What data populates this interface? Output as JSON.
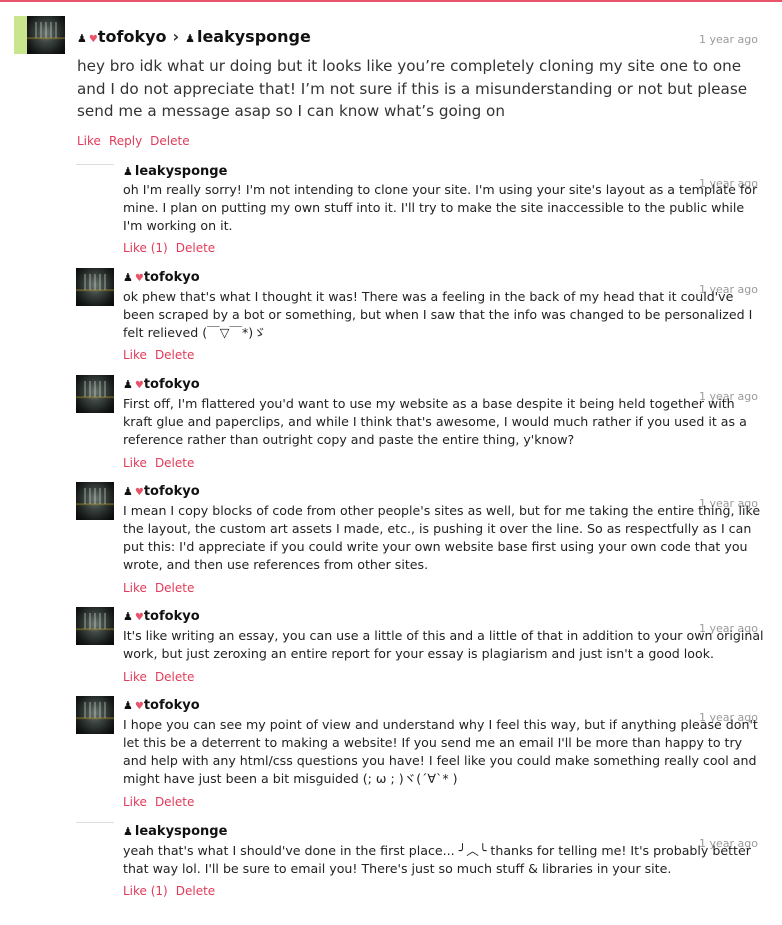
{
  "main": {
    "author": "tofokyo",
    "recipient": "leakysponge",
    "separator": "›",
    "timestamp": "1 year ago",
    "text": "hey bro idk what ur doing but it looks like you’re completely cloning my site one to one and I do not appreciate that! I’m not sure if this is a misunderstanding or not but please send me a message asap so I can know what’s going on",
    "actions": {
      "like": "Like",
      "reply": "Reply",
      "delete": "Delete"
    }
  },
  "icons": {
    "user": "user-icon",
    "heart": "heart-icon",
    "accent": "#e8556b"
  },
  "replies": [
    {
      "author": "leakysponge",
      "timestamp": "1 year ago",
      "text": "oh I'm really sorry! I'm not intending to clone your site. I'm using your site's layout as a template for mine. I plan on putting my own stuff into it. I'll try to make the site inaccessible to the public while I'm working on it.",
      "like": "Like (1)",
      "delete": "Delete"
    },
    {
      "author": "tofokyo",
      "timestamp": "1 year ago",
      "text": "ok phew that's what I thought it was! There was a feeling in the back of my head that it could've been scraped by a bot or something, but when I saw that the info was changed to be personalized I felt relieved (￣▽￣*)ゞ",
      "like": "Like",
      "delete": "Delete"
    },
    {
      "author": "tofokyo",
      "timestamp": "1 year ago",
      "text": "First off, I'm flattered you'd want to use my website as a base despite it being held together with kraft glue and paperclips, and while I think that's awesome, I would much rather if you used it as a reference rather than outright copy and paste the entire thing, y'know?",
      "like": "Like",
      "delete": "Delete"
    },
    {
      "author": "tofokyo",
      "timestamp": "1 year ago",
      "text": "I mean I copy blocks of code from other people's sites as well, but for me taking the entire thing, like the layout, the custom art assets I made, etc., is pushing it over the line. So as respectfully as I can put this: I'd appreciate if you could write your own website base first using your own code that you wrote, and then use references from other sites.",
      "like": "Like",
      "delete": "Delete"
    },
    {
      "author": "tofokyo",
      "timestamp": "1 year ago",
      "text": "It's like writing an essay, you can use a little of this and a little of that in addition to your own original work, but just zeroxing an entire report for your essay is plagiarism and just isn't a good look.",
      "like": "Like",
      "delete": "Delete"
    },
    {
      "author": "tofokyo",
      "timestamp": "1 year ago",
      "text": "I hope you can see my point of view and understand why I feel this way, but if anything please don't let this be a deterrent to making a website! If you send me an email I'll be more than happy to try and help with any html/css questions you have! I feel like you could make something really cool and might have just been a bit misguided (; ω ; )ヾ(´∀`* )",
      "like": "Like",
      "delete": "Delete"
    },
    {
      "author": "leakysponge",
      "timestamp": "1 year ago",
      "text": "yeah that's what I should've done in the first place... ╯︿╰ thanks for telling me! It's probably better that way lol. I'll be sure to email you! There's just so much stuff & libraries in your site.",
      "like": "Like (1)",
      "delete": "Delete"
    }
  ]
}
